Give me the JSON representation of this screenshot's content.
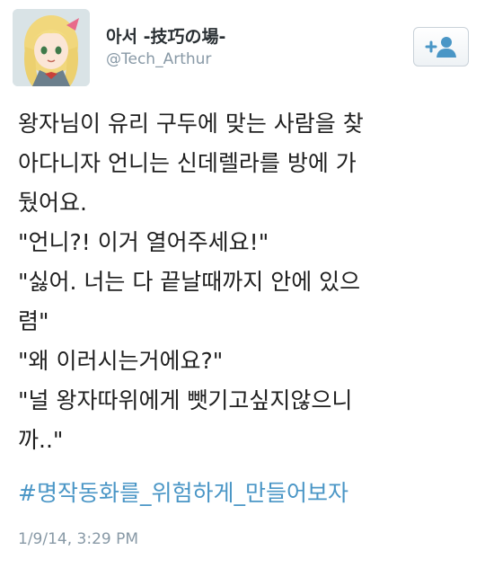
{
  "user": {
    "display_name": "아서 -技巧の場-",
    "handle": "@Tech_Arthur"
  },
  "follow_button": {
    "icon": "follow-person-plus-icon"
  },
  "tweet": {
    "lines": [
      "왕자님이 유리 구두에 맞는 사람을 찾",
      "아다니자 언니는 신데렐라를 방에 가",
      "뒀어요.",
      "\"언니?! 이거 열어주세요!\"",
      "\"싫어. 너는 다 끝날때까지 안에 있으",
      "렴\"",
      "\"왜 이러시는거에요?\"",
      "\"널 왕자따위에게 뺏기고싶지않으니",
      "까..\""
    ],
    "hashtag": "#명작동화를_위험하게_만들어보자",
    "timestamp": "1/9/14, 3:29 PM"
  },
  "colors": {
    "hashtag": "#4a96c6",
    "meta_gray": "#8899a6",
    "text": "#1f1f1f"
  }
}
